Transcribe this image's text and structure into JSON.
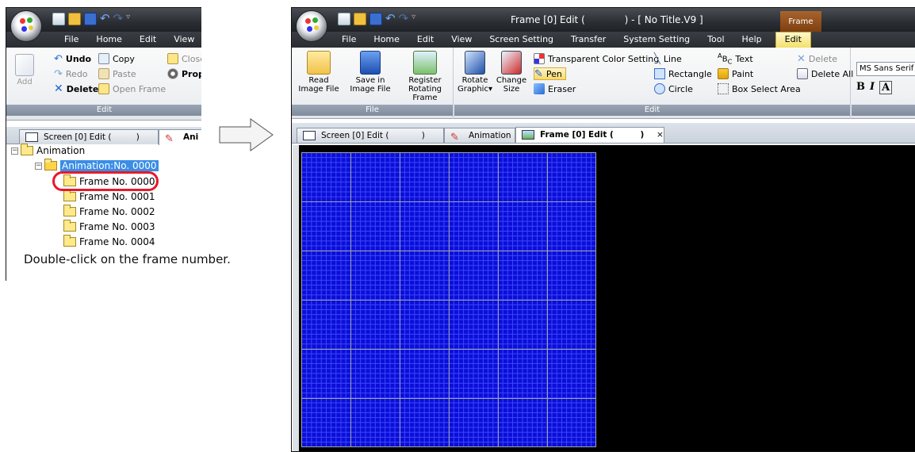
{
  "left": {
    "menu": [
      "File",
      "Home",
      "Edit",
      "View"
    ],
    "ribbon": {
      "add_label": "Add",
      "undo": "Undo",
      "redo": "Redo",
      "delete": "Delete",
      "copy": "Copy",
      "paste": "Paste",
      "open_frame": "Open Frame",
      "close": "Close",
      "prop": "Prop",
      "group_label": "Edit"
    },
    "tabs": [
      "Screen [0] Edit (",
      ")",
      "Ani"
    ],
    "tree": {
      "root": "Animation",
      "animation": "Animation:No. 0000",
      "frames": [
        "Frame No. 0000",
        "Frame No. 0001",
        "Frame No. 0002",
        "Frame No. 0003",
        "Frame No. 0004"
      ]
    }
  },
  "instruction": "Double-click on the frame number.",
  "right": {
    "title": "Frame [0] Edit (",
    "title_suffix": ") - [ No Title.V9 ]",
    "context_tab": "Frame",
    "menu": [
      "File",
      "Home",
      "Edit",
      "View",
      "Screen Setting",
      "Transfer",
      "System Setting",
      "Tool",
      "Help"
    ],
    "active_menu": "Edit",
    "ribbon": {
      "read_image": [
        "Read",
        "Image File"
      ],
      "save_image": [
        "Save in",
        "Image File"
      ],
      "register_rotating": [
        "Register",
        "Rotating Frame"
      ],
      "file_group": "File",
      "rotate_graphic": [
        "Rotate",
        "Graphic"
      ],
      "change_size": [
        "Change",
        "Size"
      ],
      "transparent": "Transparent Color Setting",
      "pen": "Pen",
      "eraser": "Eraser",
      "line": "Line",
      "rectangle": "Rectangle",
      "circle": "Circle",
      "text": "Text",
      "paint": "Paint",
      "box_select": "Box Select Area",
      "delete": "Delete",
      "delete_all": "Delete All",
      "edit_group": "Edit",
      "font_name": "MS Sans Serif",
      "bold": "B",
      "italic": "I",
      "outline": "A"
    },
    "tabs": [
      "Screen [0] Edit (",
      ")",
      "Animation",
      "Frame [0] Edit (",
      ")",
      "×"
    ]
  },
  "colors": {
    "canvas_bg": "#000000",
    "grid_fill": "#0b0fd6",
    "highlight_ring": "#e8182a",
    "selection": "#3a8ee6"
  }
}
